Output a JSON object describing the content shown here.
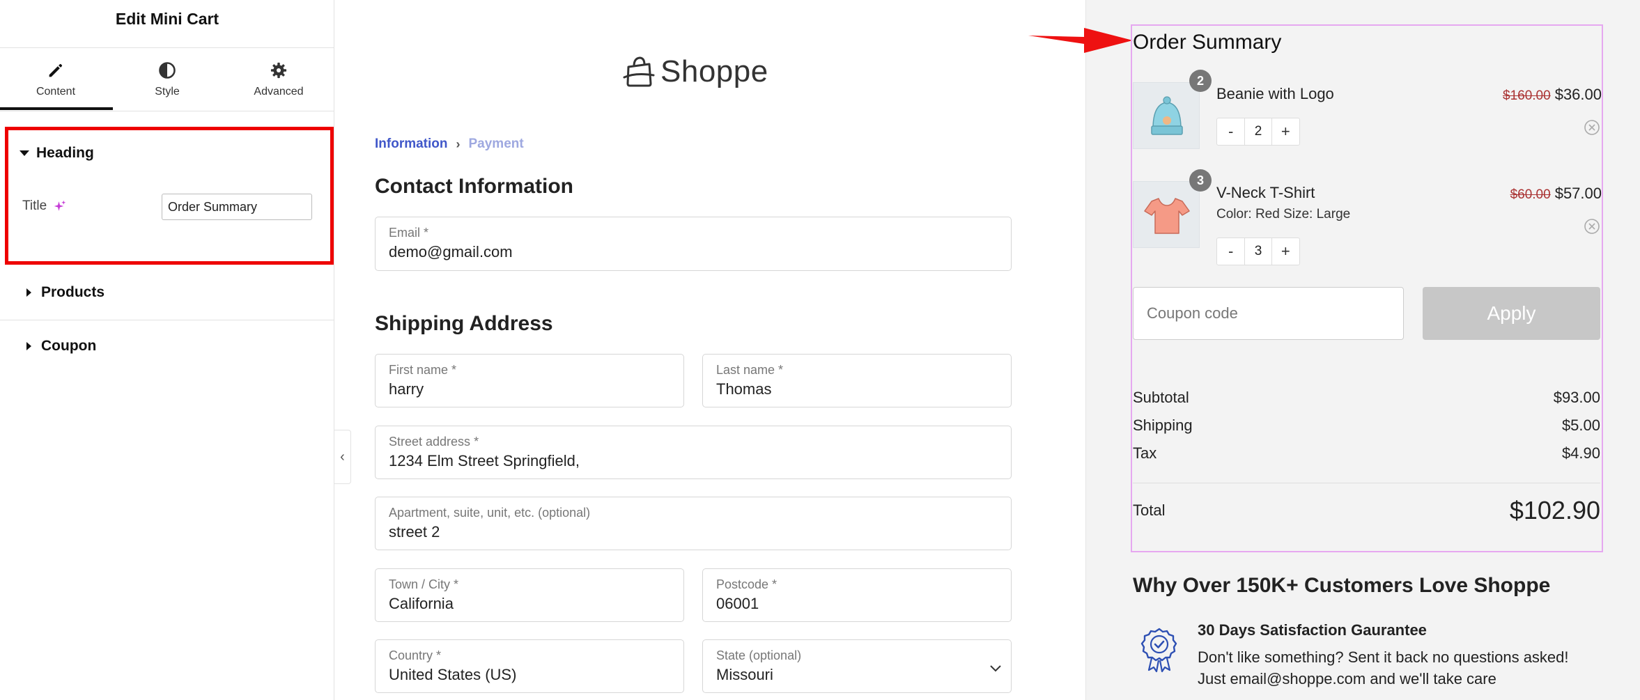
{
  "editor": {
    "title": "Edit Mini Cart",
    "tabs": [
      {
        "label": "Content",
        "icon": "pencil-icon"
      },
      {
        "label": "Style",
        "icon": "half-circle-icon"
      },
      {
        "label": "Advanced",
        "icon": "gear-icon"
      }
    ],
    "active_tab": "Content",
    "sections": {
      "heading": {
        "label": "Heading",
        "title_label": "Title",
        "title_value": "Order Summary"
      },
      "products": {
        "label": "Products"
      },
      "coupon": {
        "label": "Coupon"
      }
    },
    "highlight_color": "#ee0000"
  },
  "checkout": {
    "logo_text": "Shoppe",
    "breadcrumb": {
      "step1": "Information",
      "step2": "Payment"
    },
    "contact_title": "Contact Information",
    "email": {
      "label": "Email *",
      "value": "demo@gmail.com"
    },
    "shipping_title": "Shipping Address",
    "first_name": {
      "label": "First name *",
      "value": "harry"
    },
    "last_name": {
      "label": "Last name *",
      "value": "Thomas"
    },
    "street": {
      "label": "Street address *",
      "value": "1234 Elm Street Springfield,"
    },
    "apartment": {
      "label": "Apartment, suite, unit, etc. (optional)",
      "value": "street 2"
    },
    "city": {
      "label": "Town / City *",
      "value": "California"
    },
    "postcode": {
      "label": "Postcode *",
      "value": "06001"
    },
    "country": {
      "label": "Country *",
      "value": "United States (US)"
    },
    "state": {
      "label": "State (optional)",
      "value": "Missouri"
    },
    "accent_color": "#4057c9"
  },
  "summary": {
    "title": "Order Summary",
    "items": [
      {
        "name": "Beanie with Logo",
        "old_price": "$160.00",
        "price": "$36.00",
        "quantity": "2",
        "badge": "2",
        "variant": ""
      },
      {
        "name": "V-Neck T-Shirt",
        "old_price": "$60.00",
        "price": "$57.00",
        "quantity": "3",
        "badge": "3",
        "variant": "Color:  Red Size:  Large"
      }
    ],
    "qty_minus": "-",
    "qty_plus": "+",
    "coupon_placeholder": "Coupon code",
    "apply_label": "Apply",
    "subtotal": {
      "label": "Subtotal",
      "value": "$93.00"
    },
    "shipping": {
      "label": "Shipping",
      "value": "$5.00"
    },
    "tax": {
      "label": "Tax",
      "value": "$4.90"
    },
    "total": {
      "label": "Total",
      "value": "$102.90"
    },
    "box_outline_color": "#e6a8f0",
    "arrow_color": "#ee1111"
  },
  "trust": {
    "title": "Why Over 150K+ Customers Love Shoppe",
    "guarantee_title": "30 Days Satisfaction Gaurantee",
    "guarantee_line_1": "Don't like something? Sent it back no questions asked!",
    "guarantee_line_2": "Just email@shoppe.com and we'll take care",
    "icon": "ribbon-badge-icon"
  }
}
